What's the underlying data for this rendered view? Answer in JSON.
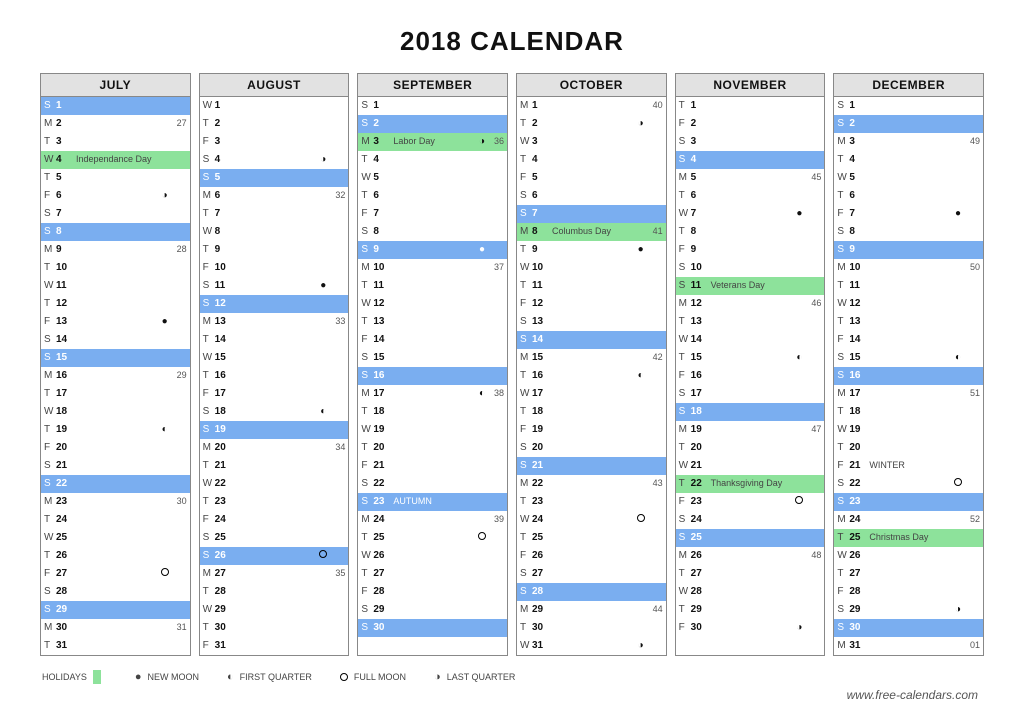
{
  "title": "2018 CALENDAR",
  "site": "www.free-calendars.com",
  "legend": {
    "holidays": "HOLIDAYS",
    "new": "NEW MOON",
    "first": "FIRST QUARTER",
    "full": "FULL MOON",
    "last": "LAST QUARTER"
  },
  "months": [
    {
      "name": "JULY",
      "days": [
        {
          "w": "S",
          "n": 1,
          "sun": 1
        },
        {
          "w": "M",
          "n": 2,
          "wk": 27
        },
        {
          "w": "T",
          "n": 3
        },
        {
          "w": "W",
          "n": 4,
          "hol": 1,
          "lbl": "Independance Day"
        },
        {
          "w": "T",
          "n": 5
        },
        {
          "w": "F",
          "n": 6,
          "moon": "last"
        },
        {
          "w": "S",
          "n": 7
        },
        {
          "w": "S",
          "n": 8,
          "sun": 1
        },
        {
          "w": "M",
          "n": 9,
          "wk": 28
        },
        {
          "w": "T",
          "n": 10
        },
        {
          "w": "W",
          "n": 11
        },
        {
          "w": "T",
          "n": 12
        },
        {
          "w": "F",
          "n": 13,
          "moon": "new"
        },
        {
          "w": "S",
          "n": 14
        },
        {
          "w": "S",
          "n": 15,
          "sun": 1
        },
        {
          "w": "M",
          "n": 16,
          "wk": 29
        },
        {
          "w": "T",
          "n": 17
        },
        {
          "w": "W",
          "n": 18
        },
        {
          "w": "T",
          "n": 19,
          "moon": "first"
        },
        {
          "w": "F",
          "n": 20
        },
        {
          "w": "S",
          "n": 21
        },
        {
          "w": "S",
          "n": 22,
          "sun": 1
        },
        {
          "w": "M",
          "n": 23,
          "wk": 30
        },
        {
          "w": "T",
          "n": 24
        },
        {
          "w": "W",
          "n": 25
        },
        {
          "w": "T",
          "n": 26
        },
        {
          "w": "F",
          "n": 27,
          "moon": "full"
        },
        {
          "w": "S",
          "n": 28
        },
        {
          "w": "S",
          "n": 29,
          "sun": 1
        },
        {
          "w": "M",
          "n": 30,
          "wk": 31
        },
        {
          "w": "T",
          "n": 31
        }
      ]
    },
    {
      "name": "AUGUST",
      "days": [
        {
          "w": "W",
          "n": 1
        },
        {
          "w": "T",
          "n": 2
        },
        {
          "w": "F",
          "n": 3
        },
        {
          "w": "S",
          "n": 4,
          "moon": "last"
        },
        {
          "w": "S",
          "n": 5,
          "sun": 1
        },
        {
          "w": "M",
          "n": 6,
          "wk": 32
        },
        {
          "w": "T",
          "n": 7
        },
        {
          "w": "W",
          "n": 8
        },
        {
          "w": "T",
          "n": 9
        },
        {
          "w": "F",
          "n": 10
        },
        {
          "w": "S",
          "n": 11,
          "moon": "new"
        },
        {
          "w": "S",
          "n": 12,
          "sun": 1
        },
        {
          "w": "M",
          "n": 13,
          "wk": 33
        },
        {
          "w": "T",
          "n": 14
        },
        {
          "w": "W",
          "n": 15
        },
        {
          "w": "T",
          "n": 16
        },
        {
          "w": "F",
          "n": 17
        },
        {
          "w": "S",
          "n": 18,
          "moon": "first"
        },
        {
          "w": "S",
          "n": 19,
          "sun": 1
        },
        {
          "w": "M",
          "n": 20,
          "wk": 34
        },
        {
          "w": "T",
          "n": 21
        },
        {
          "w": "W",
          "n": 22
        },
        {
          "w": "T",
          "n": 23
        },
        {
          "w": "F",
          "n": 24
        },
        {
          "w": "S",
          "n": 25
        },
        {
          "w": "S",
          "n": 26,
          "sun": 1,
          "moon": "full"
        },
        {
          "w": "M",
          "n": 27,
          "wk": 35
        },
        {
          "w": "T",
          "n": 28
        },
        {
          "w": "W",
          "n": 29
        },
        {
          "w": "T",
          "n": 30
        },
        {
          "w": "F",
          "n": 31
        }
      ]
    },
    {
      "name": "SEPTEMBER",
      "days": [
        {
          "w": "S",
          "n": 1
        },
        {
          "w": "S",
          "n": 2,
          "sun": 1
        },
        {
          "w": "M",
          "n": 3,
          "hol": 1,
          "lbl": "Labor Day",
          "moon": "last",
          "wk": 36
        },
        {
          "w": "T",
          "n": 4
        },
        {
          "w": "W",
          "n": 5
        },
        {
          "w": "T",
          "n": 6
        },
        {
          "w": "F",
          "n": 7
        },
        {
          "w": "S",
          "n": 8
        },
        {
          "w": "S",
          "n": 9,
          "sun": 1,
          "moon": "new"
        },
        {
          "w": "M",
          "n": 10,
          "wk": 37
        },
        {
          "w": "T",
          "n": 11
        },
        {
          "w": "W",
          "n": 12
        },
        {
          "w": "T",
          "n": 13
        },
        {
          "w": "F",
          "n": 14
        },
        {
          "w": "S",
          "n": 15
        },
        {
          "w": "S",
          "n": 16,
          "sun": 1
        },
        {
          "w": "M",
          "n": 17,
          "moon": "first",
          "wk": 38
        },
        {
          "w": "T",
          "n": 18
        },
        {
          "w": "W",
          "n": 19
        },
        {
          "w": "T",
          "n": 20
        },
        {
          "w": "F",
          "n": 21
        },
        {
          "w": "S",
          "n": 22
        },
        {
          "w": "S",
          "n": 23,
          "sun": 1,
          "lbl": "AUTUMN"
        },
        {
          "w": "M",
          "n": 24,
          "wk": 39
        },
        {
          "w": "T",
          "n": 25,
          "moon": "full"
        },
        {
          "w": "W",
          "n": 26
        },
        {
          "w": "T",
          "n": 27
        },
        {
          "w": "F",
          "n": 28
        },
        {
          "w": "S",
          "n": 29
        },
        {
          "w": "S",
          "n": 30,
          "sun": 1
        }
      ]
    },
    {
      "name": "OCTOBER",
      "days": [
        {
          "w": "M",
          "n": 1,
          "wk": 40
        },
        {
          "w": "T",
          "n": 2,
          "moon": "last"
        },
        {
          "w": "W",
          "n": 3
        },
        {
          "w": "T",
          "n": 4
        },
        {
          "w": "F",
          "n": 5
        },
        {
          "w": "S",
          "n": 6
        },
        {
          "w": "S",
          "n": 7,
          "sun": 1
        },
        {
          "w": "M",
          "n": 8,
          "hol": 1,
          "lbl": "Columbus Day",
          "wk": 41
        },
        {
          "w": "T",
          "n": 9,
          "moon": "new"
        },
        {
          "w": "W",
          "n": 10
        },
        {
          "w": "T",
          "n": 11
        },
        {
          "w": "F",
          "n": 12
        },
        {
          "w": "S",
          "n": 13
        },
        {
          "w": "S",
          "n": 14,
          "sun": 1
        },
        {
          "w": "M",
          "n": 15,
          "wk": 42
        },
        {
          "w": "T",
          "n": 16,
          "moon": "first"
        },
        {
          "w": "W",
          "n": 17
        },
        {
          "w": "T",
          "n": 18
        },
        {
          "w": "F",
          "n": 19
        },
        {
          "w": "S",
          "n": 20
        },
        {
          "w": "S",
          "n": 21,
          "sun": 1
        },
        {
          "w": "M",
          "n": 22,
          "wk": 43
        },
        {
          "w": "T",
          "n": 23
        },
        {
          "w": "W",
          "n": 24,
          "moon": "full"
        },
        {
          "w": "T",
          "n": 25
        },
        {
          "w": "F",
          "n": 26
        },
        {
          "w": "S",
          "n": 27
        },
        {
          "w": "S",
          "n": 28,
          "sun": 1
        },
        {
          "w": "M",
          "n": 29,
          "wk": 44
        },
        {
          "w": "T",
          "n": 30
        },
        {
          "w": "W",
          "n": 31,
          "moon": "last"
        }
      ]
    },
    {
      "name": "NOVEMBER",
      "days": [
        {
          "w": "T",
          "n": 1
        },
        {
          "w": "F",
          "n": 2
        },
        {
          "w": "S",
          "n": 3
        },
        {
          "w": "S",
          "n": 4,
          "sun": 1
        },
        {
          "w": "M",
          "n": 5,
          "wk": 45
        },
        {
          "w": "T",
          "n": 6
        },
        {
          "w": "W",
          "n": 7,
          "moon": "new"
        },
        {
          "w": "T",
          "n": 8
        },
        {
          "w": "F",
          "n": 9
        },
        {
          "w": "S",
          "n": 10
        },
        {
          "w": "S",
          "n": 11,
          "hol": 1,
          "lbl": "Veterans Day"
        },
        {
          "w": "M",
          "n": 12,
          "wk": 46
        },
        {
          "w": "T",
          "n": 13
        },
        {
          "w": "W",
          "n": 14
        },
        {
          "w": "T",
          "n": 15,
          "moon": "first"
        },
        {
          "w": "F",
          "n": 16
        },
        {
          "w": "S",
          "n": 17
        },
        {
          "w": "S",
          "n": 18,
          "sun": 1
        },
        {
          "w": "M",
          "n": 19,
          "wk": 47
        },
        {
          "w": "T",
          "n": 20
        },
        {
          "w": "W",
          "n": 21
        },
        {
          "w": "T",
          "n": 22,
          "hol": 1,
          "lbl": "Thanksgiving Day"
        },
        {
          "w": "F",
          "n": 23,
          "moon": "full"
        },
        {
          "w": "S",
          "n": 24
        },
        {
          "w": "S",
          "n": 25,
          "sun": 1
        },
        {
          "w": "M",
          "n": 26,
          "wk": 48
        },
        {
          "w": "T",
          "n": 27
        },
        {
          "w": "W",
          "n": 28
        },
        {
          "w": "T",
          "n": 29
        },
        {
          "w": "F",
          "n": 30,
          "moon": "last"
        }
      ]
    },
    {
      "name": "DECEMBER",
      "days": [
        {
          "w": "S",
          "n": 1
        },
        {
          "w": "S",
          "n": 2,
          "sun": 1
        },
        {
          "w": "M",
          "n": 3,
          "wk": 49
        },
        {
          "w": "T",
          "n": 4
        },
        {
          "w": "W",
          "n": 5
        },
        {
          "w": "T",
          "n": 6
        },
        {
          "w": "F",
          "n": 7,
          "moon": "new"
        },
        {
          "w": "S",
          "n": 8
        },
        {
          "w": "S",
          "n": 9,
          "sun": 1
        },
        {
          "w": "M",
          "n": 10,
          "wk": 50
        },
        {
          "w": "T",
          "n": 11
        },
        {
          "w": "W",
          "n": 12
        },
        {
          "w": "T",
          "n": 13
        },
        {
          "w": "F",
          "n": 14
        },
        {
          "w": "S",
          "n": 15,
          "moon": "first"
        },
        {
          "w": "S",
          "n": 16,
          "sun": 1
        },
        {
          "w": "M",
          "n": 17,
          "wk": 51
        },
        {
          "w": "T",
          "n": 18
        },
        {
          "w": "W",
          "n": 19
        },
        {
          "w": "T",
          "n": 20
        },
        {
          "w": "F",
          "n": 21,
          "lbl": "WINTER"
        },
        {
          "w": "S",
          "n": 22,
          "moon": "full"
        },
        {
          "w": "S",
          "n": 23,
          "sun": 1
        },
        {
          "w": "M",
          "n": 24,
          "wk": 52
        },
        {
          "w": "T",
          "n": 25,
          "hol": 1,
          "lbl": "Christmas Day"
        },
        {
          "w": "W",
          "n": 26
        },
        {
          "w": "T",
          "n": 27
        },
        {
          "w": "F",
          "n": 28
        },
        {
          "w": "S",
          "n": 29,
          "moon": "last"
        },
        {
          "w": "S",
          "n": 30,
          "sun": 1
        },
        {
          "w": "M",
          "n": 31,
          "wk": "01"
        }
      ]
    }
  ]
}
